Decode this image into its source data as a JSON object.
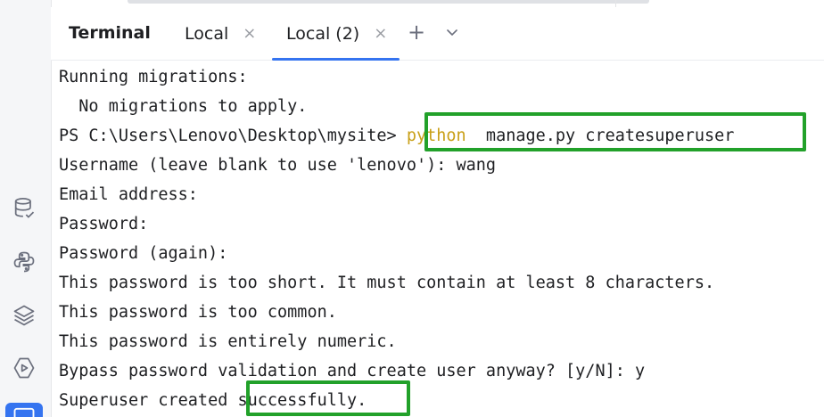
{
  "tabs": {
    "title": "Terminal",
    "items": [
      {
        "label": "Local",
        "close": "×",
        "active": false
      },
      {
        "label": "Local (2)",
        "close": "×",
        "active": true
      }
    ],
    "new_tab_symbol": "+",
    "more_symbol": "⌄"
  },
  "sidebar": {
    "icons": [
      "database-icon",
      "python-icon",
      "layers-icon",
      "run-icon",
      "terminal-icon"
    ]
  },
  "terminal": {
    "lines": [
      "Running migrations:",
      "  No migrations to apply.",
      "PS C:\\Users\\Lenovo\\Desktop\\mysite> ",
      "Username (leave blank to use 'lenovo'): wang",
      "Email address:",
      "Password:",
      "Password (again):",
      "This password is too short. It must contain at least 8 characters.",
      "This password is too common.",
      "This password is entirely numeric.",
      "Bypass password validation and create user anyway? [y/N]: y",
      "Superuser created "
    ],
    "command_python": "python",
    "command_rest": "  manage.py createsuperuser",
    "success_word": "successfully."
  },
  "colors": {
    "highlight": "#22a12a",
    "python_keyword": "#c9a019",
    "active_tab_underline": "#3574f0"
  }
}
